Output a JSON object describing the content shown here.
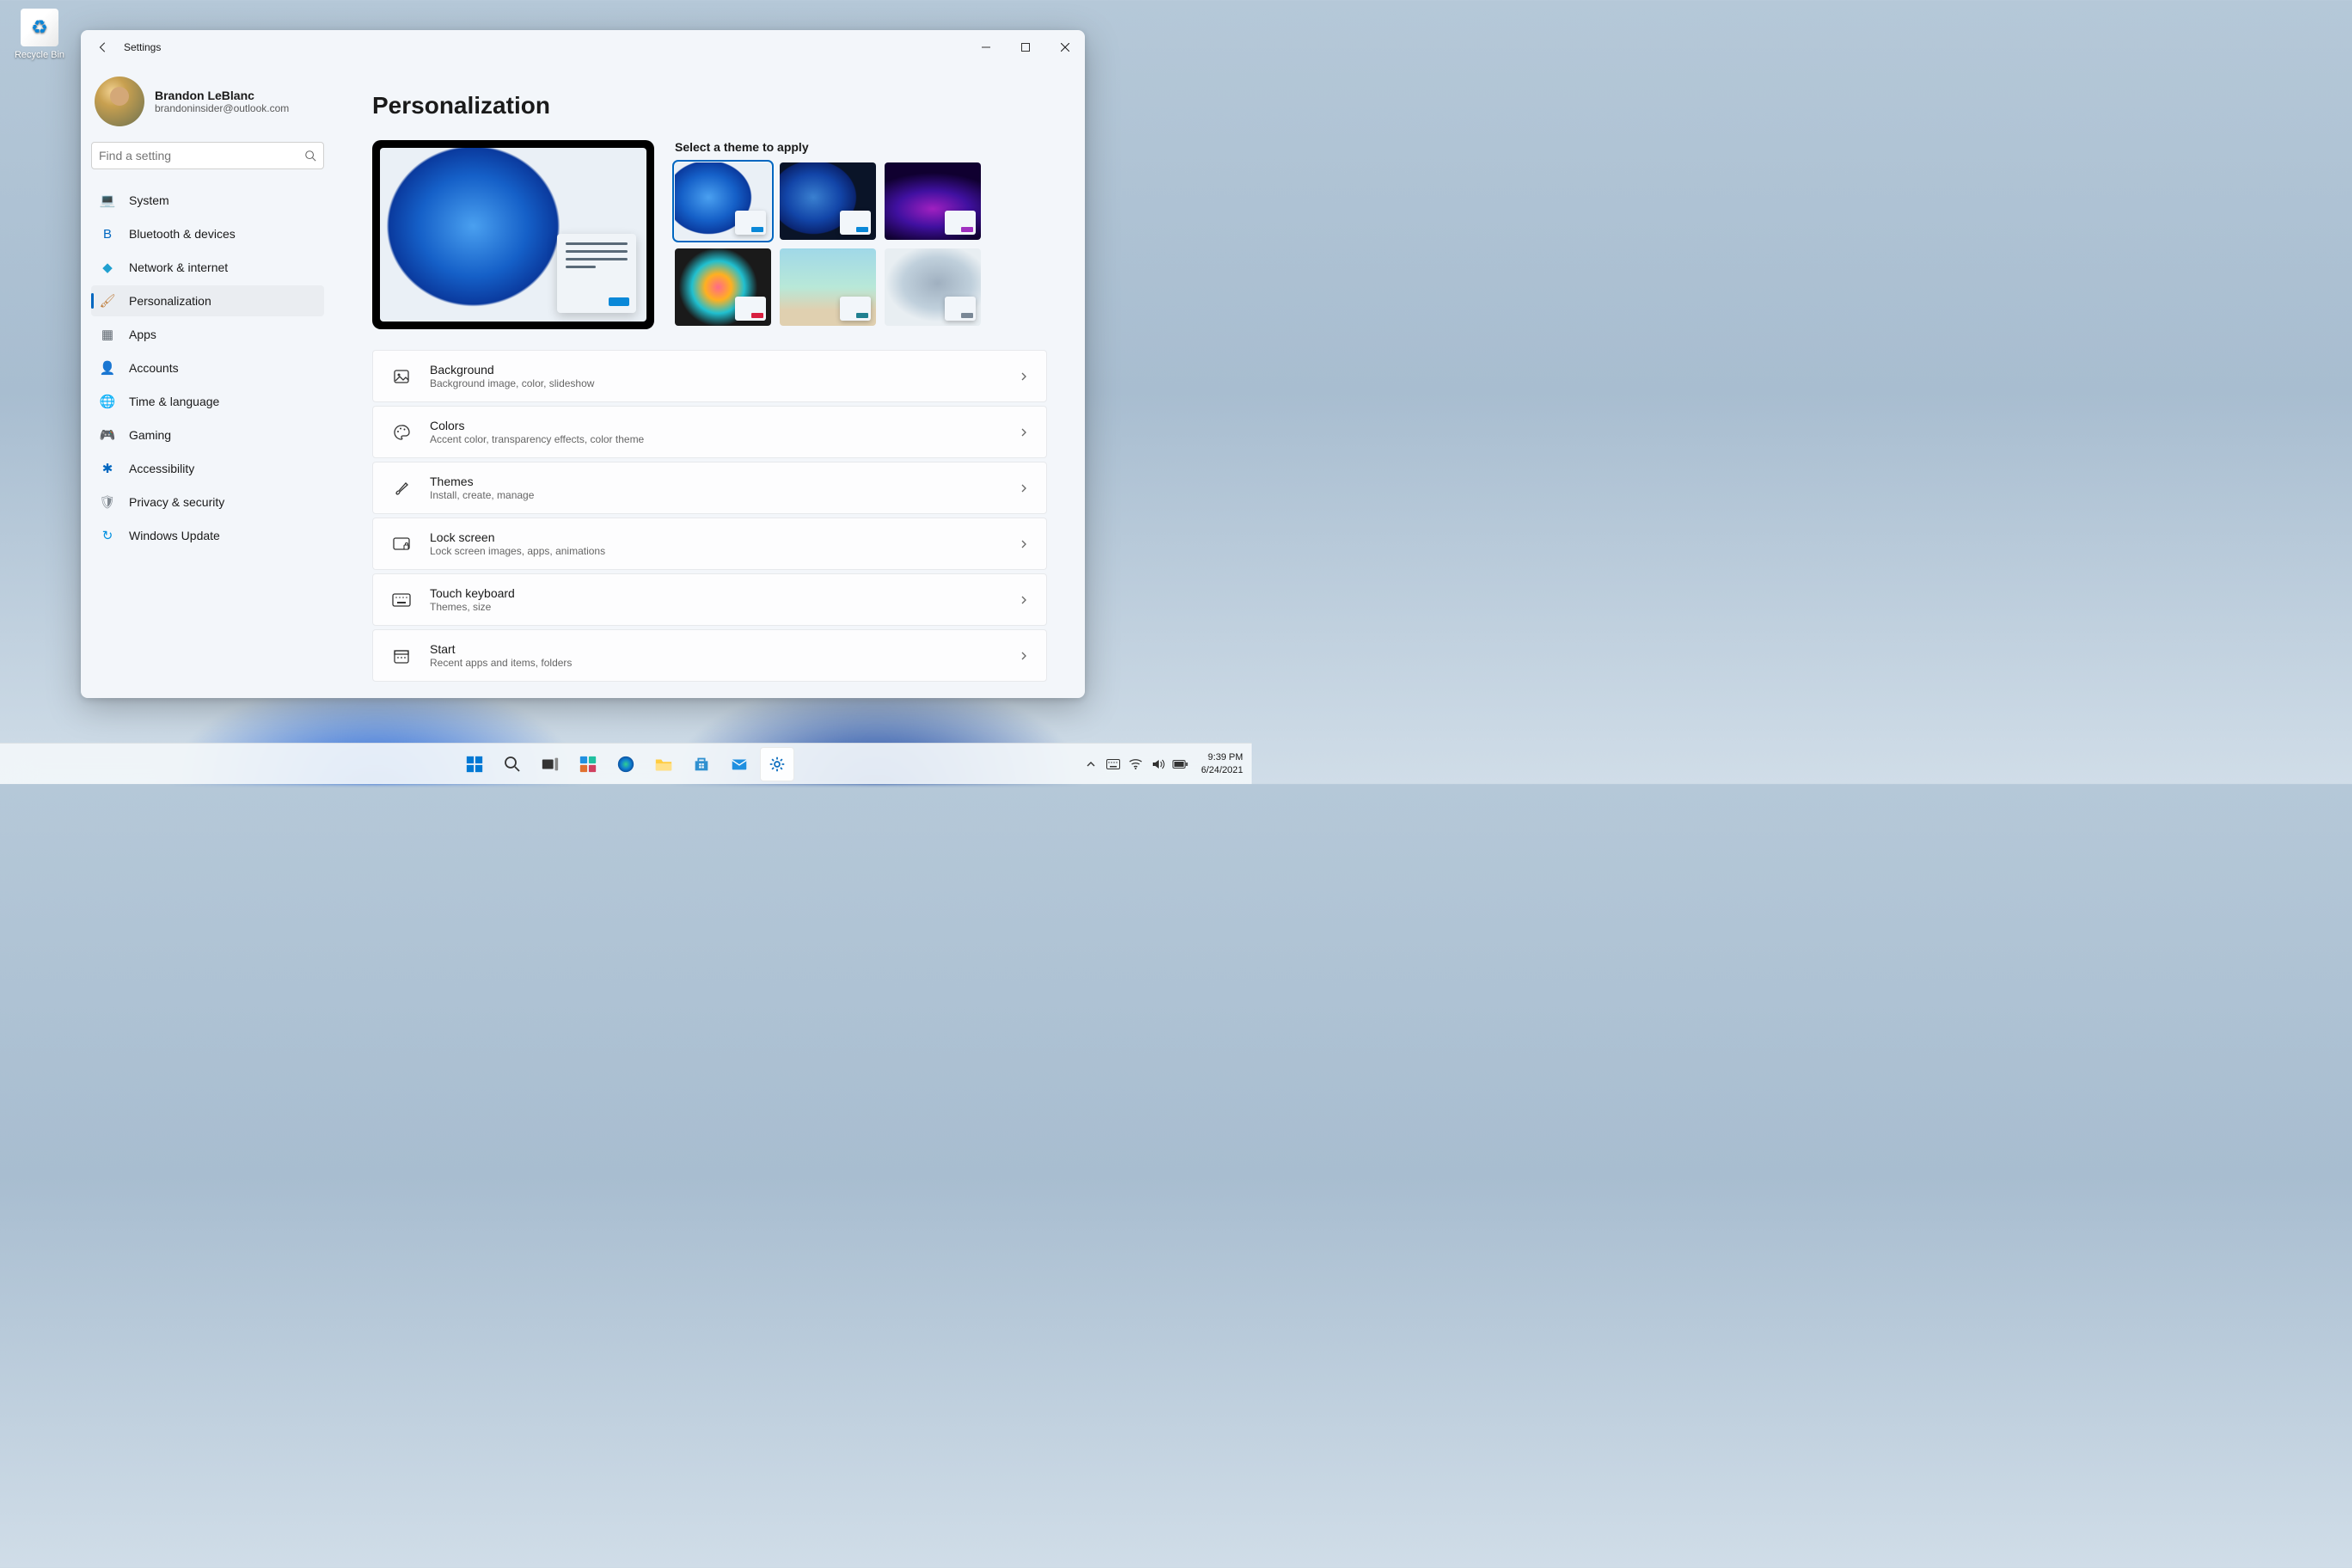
{
  "desktop": {
    "recycle_label": "Recycle Bin"
  },
  "window": {
    "app_title": "Settings",
    "user_name": "Brandon LeBlanc",
    "user_mail": "brandoninsider@outlook.com",
    "search_placeholder": "Find a setting",
    "page_title": "Personalization",
    "theme_select_label": "Select a theme to apply"
  },
  "nav": [
    {
      "label": "System",
      "icon": "💻",
      "color": "#0067c0"
    },
    {
      "label": "Bluetooth & devices",
      "icon": "B",
      "color": "#0067c0"
    },
    {
      "label": "Network & internet",
      "icon": "◆",
      "color": "#20a0d0"
    },
    {
      "label": "Personalization",
      "icon": "🖌",
      "color": "#c08040",
      "active": true
    },
    {
      "label": "Apps",
      "icon": "▦",
      "color": "#606870"
    },
    {
      "label": "Accounts",
      "icon": "👤",
      "color": "#20a060"
    },
    {
      "label": "Time & language",
      "icon": "🌐",
      "color": "#3090d0"
    },
    {
      "label": "Gaming",
      "icon": "🎮",
      "color": "#808890"
    },
    {
      "label": "Accessibility",
      "icon": "✱",
      "color": "#0067c0"
    },
    {
      "label": "Privacy & security",
      "icon": "🛡",
      "color": "#808890"
    },
    {
      "label": "Windows Update",
      "icon": "↻",
      "color": "#0090e0"
    }
  ],
  "themes": [
    {
      "accent": "#0a88d8",
      "bg": "bg-bloom-light",
      "selected": true
    },
    {
      "accent": "#0a88d8",
      "bg": "bg-bloom-dark"
    },
    {
      "accent": "#a030c0",
      "bg": "bg-abstract-purple"
    },
    {
      "accent": "#d82040",
      "bg": "bg-flower"
    },
    {
      "accent": "#208090",
      "bg": "bg-beach"
    },
    {
      "accent": "#7a8896",
      "bg": "bg-flow"
    }
  ],
  "cards": [
    {
      "title": "Background",
      "sub": "Background image, color, slideshow",
      "icon": "image"
    },
    {
      "title": "Colors",
      "sub": "Accent color, transparency effects, color theme",
      "icon": "palette"
    },
    {
      "title": "Themes",
      "sub": "Install, create, manage",
      "icon": "brush"
    },
    {
      "title": "Lock screen",
      "sub": "Lock screen images, apps, animations",
      "icon": "lock"
    },
    {
      "title": "Touch keyboard",
      "sub": "Themes, size",
      "icon": "keyboard"
    },
    {
      "title": "Start",
      "sub": "Recent apps and items, folders",
      "icon": "start"
    }
  ],
  "taskbar": {
    "time": "9:39 PM",
    "date": "6/24/2021"
  }
}
